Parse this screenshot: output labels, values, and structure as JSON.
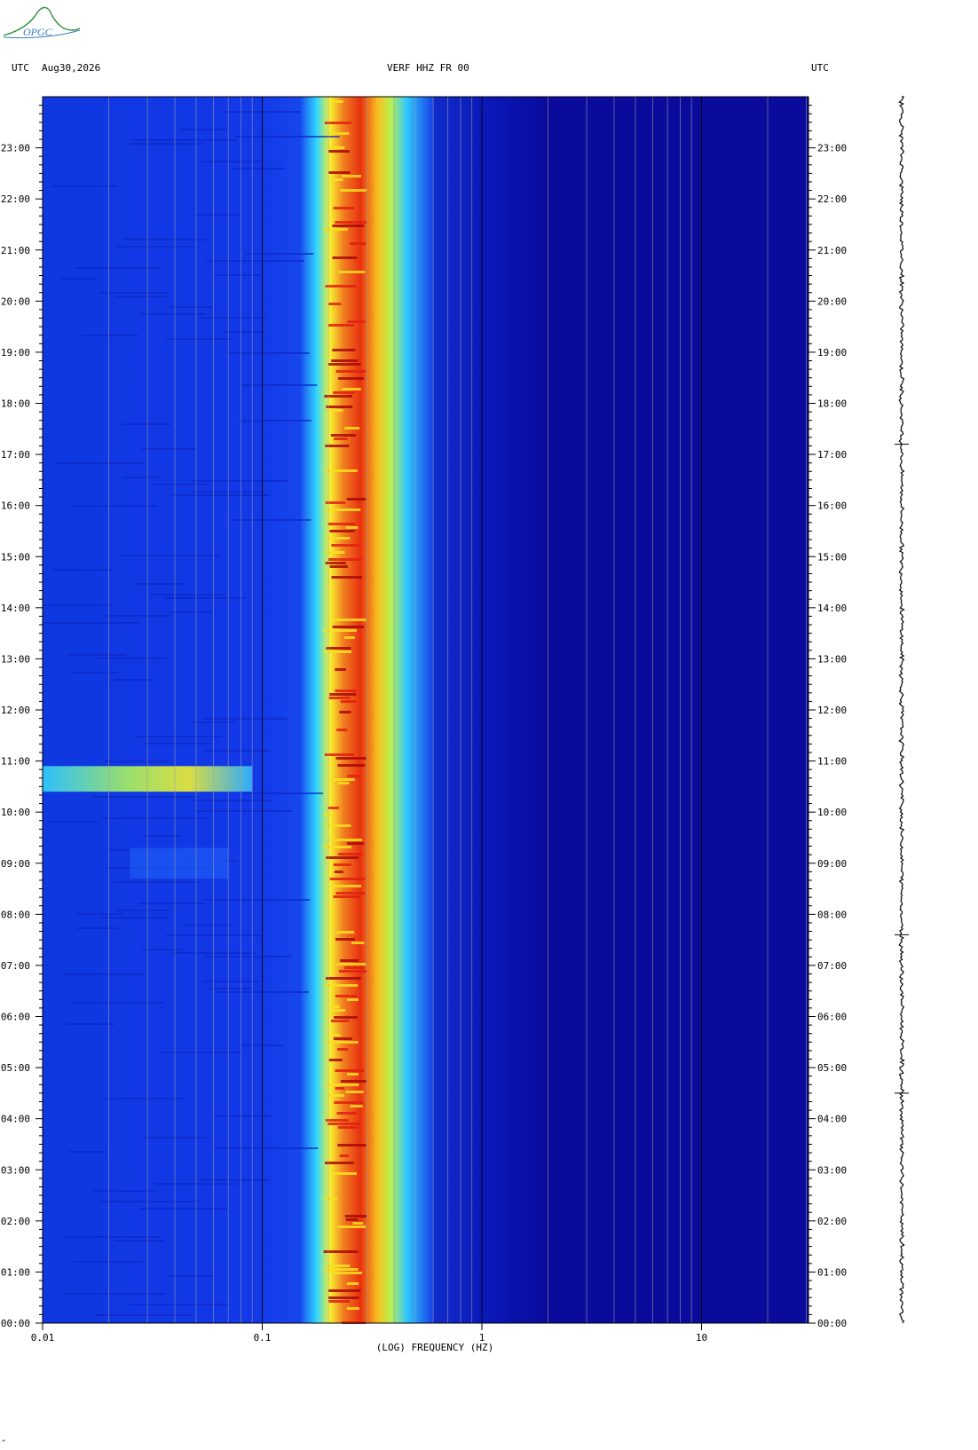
{
  "header": {
    "left_tz": "UTC",
    "date": "Aug30,2026",
    "station": "VERF HHZ FR 00",
    "right_tz": "UTC"
  },
  "logo": {
    "text": "OPGC",
    "color": "#2f8f3a"
  },
  "colors": {
    "background": "#0a0a9c",
    "low": "#1030e0",
    "mid": "#30e0ff",
    "high": "#ffff20",
    "peak": "#e01010",
    "gridline": "#a0a0a0"
  },
  "chart_data": {
    "type": "heatmap",
    "title": "",
    "xlabel": "(LOG) FREQUENCY (HZ)",
    "ylabel": "",
    "x_scale": "log",
    "xlim": [
      0.01,
      30
    ],
    "x_tick_values": [
      0.01,
      0.1,
      1,
      10
    ],
    "x_tick_labels": [
      "0.01",
      "0.1",
      "1",
      "10"
    ],
    "ylim_hours": [
      0,
      24
    ],
    "y_tick_labels": [
      "00:00",
      "01:00",
      "02:00",
      "03:00",
      "04:00",
      "05:00",
      "06:00",
      "07:00",
      "08:00",
      "09:00",
      "10:00",
      "11:00",
      "12:00",
      "13:00",
      "14:00",
      "15:00",
      "16:00",
      "17:00",
      "18:00",
      "19:00",
      "20:00",
      "21:00",
      "22:00",
      "23:00"
    ],
    "features": {
      "microseism_band_hz": [
        0.15,
        0.6
      ],
      "microseism_peak_hz": [
        0.19,
        0.3
      ],
      "transient_event": {
        "hour_start": 10.4,
        "hour_end": 10.9,
        "freq_hz": [
          0.01,
          0.09
        ]
      }
    }
  }
}
